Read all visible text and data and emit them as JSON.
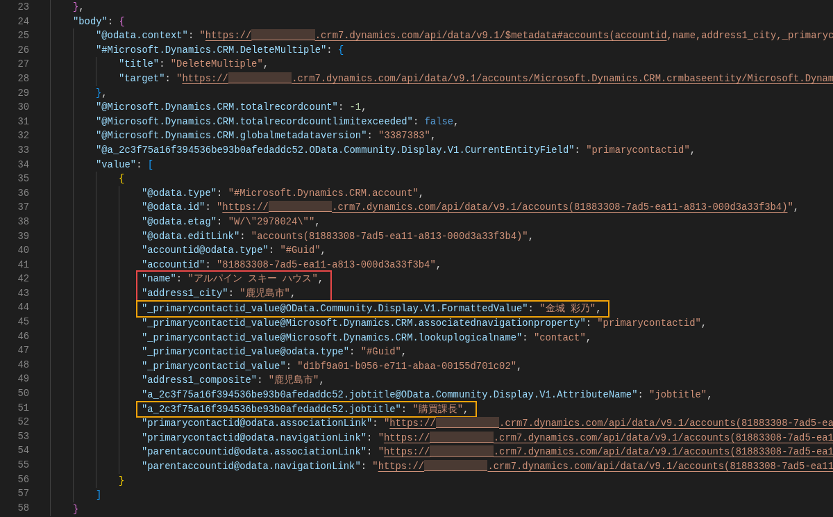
{
  "editor": {
    "lines": [
      {
        "number": "23",
        "tokens": [
          {
            "kind": "bracket",
            "text": "}",
            "color": "#da70d6"
          },
          {
            "kind": "punct",
            "text": ","
          }
        ]
      },
      {
        "number": "24",
        "tokens": [
          {
            "kind": "key",
            "text": "\"body\""
          },
          {
            "kind": "punct",
            "text": ": "
          },
          {
            "kind": "bracket",
            "text": "{",
            "color": "#da70d6"
          }
        ],
        "children": [
          {
            "number": "25",
            "tokens": [
              {
                "kind": "key",
                "text": "\"@odata.context\""
              },
              {
                "kind": "punct",
                "text": ": "
              },
              {
                "kind": "string",
                "text": "\""
              },
              {
                "kind": "link",
                "text": "https://"
              },
              {
                "kind": "redacted"
              },
              {
                "kind": "link",
                "text": ".crm7.dynamics.com/api/data/v9.1/$metadata#accounts(accountid"
              },
              {
                "kind": "string",
                "text": ",name,address1_city,_primaryc"
              }
            ]
          },
          {
            "number": "26",
            "tokens": [
              {
                "kind": "key",
                "text": "\"#Microsoft.Dynamics.CRM.DeleteMultiple\""
              },
              {
                "kind": "punct",
                "text": ": "
              },
              {
                "kind": "bracket",
                "text": "{",
                "color": "#179fff"
              }
            ],
            "children": [
              {
                "number": "27",
                "tokens": [
                  {
                    "kind": "key",
                    "text": "\"title\""
                  },
                  {
                    "kind": "punct",
                    "text": ": "
                  },
                  {
                    "kind": "string",
                    "text": "\"DeleteMultiple\""
                  },
                  {
                    "kind": "punct",
                    "text": ","
                  }
                ]
              },
              {
                "number": "28",
                "tokens": [
                  {
                    "kind": "key",
                    "text": "\"target\""
                  },
                  {
                    "kind": "punct",
                    "text": ": "
                  },
                  {
                    "kind": "string",
                    "text": "\""
                  },
                  {
                    "kind": "link",
                    "text": "https://"
                  },
                  {
                    "kind": "redacted"
                  },
                  {
                    "kind": "link",
                    "text": ".crm7.dynamics.com/api/data/v9.1/accounts/Microsoft.Dynamics.CRM.crmbaseentity/Microsoft.Dynam"
                  }
                ]
              }
            ]
          },
          {
            "number": "29",
            "tokens": [
              {
                "kind": "bracket",
                "text": "}",
                "color": "#179fff"
              },
              {
                "kind": "punct",
                "text": ","
              }
            ]
          },
          {
            "number": "30",
            "tokens": [
              {
                "kind": "key",
                "text": "\"@Microsoft.Dynamics.CRM.totalrecordcount\""
              },
              {
                "kind": "punct",
                "text": ": "
              },
              {
                "kind": "number",
                "text": "-1"
              },
              {
                "kind": "punct",
                "text": ","
              }
            ]
          },
          {
            "number": "31",
            "tokens": [
              {
                "kind": "key",
                "text": "\"@Microsoft.Dynamics.CRM.totalrecordcountlimitexceeded\""
              },
              {
                "kind": "punct",
                "text": ": "
              },
              {
                "kind": "keyword",
                "text": "false"
              },
              {
                "kind": "punct",
                "text": ","
              }
            ]
          },
          {
            "number": "32",
            "tokens": [
              {
                "kind": "key",
                "text": "\"@Microsoft.Dynamics.CRM.globalmetadataversion\""
              },
              {
                "kind": "punct",
                "text": ": "
              },
              {
                "kind": "string",
                "text": "\"3387383\""
              },
              {
                "kind": "punct",
                "text": ","
              }
            ]
          },
          {
            "number": "33",
            "tokens": [
              {
                "kind": "key",
                "text": "\"@a_2c3f75a16f394536be93b0afedaddc52.OData.Community.Display.V1.CurrentEntityField\""
              },
              {
                "kind": "punct",
                "text": ": "
              },
              {
                "kind": "string",
                "text": "\"primarycontactid\""
              },
              {
                "kind": "punct",
                "text": ","
              }
            ]
          },
          {
            "number": "34",
            "tokens": [
              {
                "kind": "key",
                "text": "\"value\""
              },
              {
                "kind": "punct",
                "text": ": "
              },
              {
                "kind": "bracket",
                "text": "[",
                "color": "#179fff"
              }
            ],
            "children": [
              {
                "number": "35",
                "tokens": [
                  {
                    "kind": "bracket",
                    "text": "{",
                    "color": "#ffd700"
                  }
                ],
                "children": [
                  {
                    "number": "36",
                    "tokens": [
                      {
                        "kind": "key",
                        "text": "\"@odata.type\""
                      },
                      {
                        "kind": "punct",
                        "text": ": "
                      },
                      {
                        "kind": "string",
                        "text": "\"#Microsoft.Dynamics.CRM.account\""
                      },
                      {
                        "kind": "punct",
                        "text": ","
                      }
                    ]
                  },
                  {
                    "number": "37",
                    "tokens": [
                      {
                        "kind": "key",
                        "text": "\"@odata.id\""
                      },
                      {
                        "kind": "punct",
                        "text": ": "
                      },
                      {
                        "kind": "string",
                        "text": "\""
                      },
                      {
                        "kind": "link",
                        "text": "https://"
                      },
                      {
                        "kind": "redacted"
                      },
                      {
                        "kind": "link",
                        "text": ".crm7.dynamics.com/api/data/v9.1/accounts(81883308-7ad5-ea11-a813-000d3a33f3b4)"
                      },
                      {
                        "kind": "string",
                        "text": "\""
                      },
                      {
                        "kind": "punct",
                        "text": ","
                      }
                    ]
                  },
                  {
                    "number": "38",
                    "tokens": [
                      {
                        "kind": "key",
                        "text": "\"@odata.etag\""
                      },
                      {
                        "kind": "punct",
                        "text": ": "
                      },
                      {
                        "kind": "string",
                        "text": "\"W/\\\"2978024\\\"\""
                      },
                      {
                        "kind": "punct",
                        "text": ","
                      }
                    ]
                  },
                  {
                    "number": "39",
                    "tokens": [
                      {
                        "kind": "key",
                        "text": "\"@odata.editLink\""
                      },
                      {
                        "kind": "punct",
                        "text": ": "
                      },
                      {
                        "kind": "string",
                        "text": "\"accounts(81883308-7ad5-ea11-a813-000d3a33f3b4)\""
                      },
                      {
                        "kind": "punct",
                        "text": ","
                      }
                    ]
                  },
                  {
                    "number": "40",
                    "tokens": [
                      {
                        "kind": "key",
                        "text": "\"accountid@odata.type\""
                      },
                      {
                        "kind": "punct",
                        "text": ": "
                      },
                      {
                        "kind": "string",
                        "text": "\"#Guid\""
                      },
                      {
                        "kind": "punct",
                        "text": ","
                      }
                    ]
                  },
                  {
                    "number": "41",
                    "tokens": [
                      {
                        "kind": "key",
                        "text": "\"accountid\""
                      },
                      {
                        "kind": "punct",
                        "text": ": "
                      },
                      {
                        "kind": "string",
                        "text": "\"81883308-7ad5-ea11-a813-000d3a33f3b4\""
                      },
                      {
                        "kind": "punct",
                        "text": ","
                      }
                    ]
                  },
                  {
                    "number": "42",
                    "color": "#e84848",
                    "tokens": [
                      {
                        "kind": "key",
                        "text": "\"name\""
                      },
                      {
                        "kind": "punct",
                        "text": ": "
                      },
                      {
                        "kind": "string",
                        "text": "\"アルパイン スキー ハウス\""
                      },
                      {
                        "kind": "punct",
                        "text": ","
                      }
                    ]
                  },
                  {
                    "number": "43",
                    "color": "#e84848",
                    "tokens": [
                      {
                        "kind": "key",
                        "text": "\"address1_city\""
                      },
                      {
                        "kind": "punct",
                        "text": ": "
                      },
                      {
                        "kind": "string",
                        "text": "\"鹿児島市\""
                      },
                      {
                        "kind": "punct",
                        "text": ","
                      }
                    ]
                  },
                  {
                    "number": "44",
                    "color": "#f0a30a",
                    "tokens": [
                      {
                        "kind": "key",
                        "text": "\"_primarycontactid_value@OData.Community.Display.V1.FormattedValue\""
                      },
                      {
                        "kind": "punct",
                        "text": ": "
                      },
                      {
                        "kind": "string",
                        "text": "\"金城 彩乃\""
                      },
                      {
                        "kind": "punct",
                        "text": ","
                      }
                    ]
                  },
                  {
                    "number": "45",
                    "tokens": [
                      {
                        "kind": "key",
                        "text": "\"_primarycontactid_value@Microsoft.Dynamics.CRM.associatednavigationproperty\""
                      },
                      {
                        "kind": "punct",
                        "text": ": "
                      },
                      {
                        "kind": "string",
                        "text": "\"primarycontactid\""
                      },
                      {
                        "kind": "punct",
                        "text": ","
                      }
                    ]
                  },
                  {
                    "number": "46",
                    "tokens": [
                      {
                        "kind": "key",
                        "text": "\"_primarycontactid_value@Microsoft.Dynamics.CRM.lookuplogicalname\""
                      },
                      {
                        "kind": "punct",
                        "text": ": "
                      },
                      {
                        "kind": "string",
                        "text": "\"contact\""
                      },
                      {
                        "kind": "punct",
                        "text": ","
                      }
                    ]
                  },
                  {
                    "number": "47",
                    "tokens": [
                      {
                        "kind": "key",
                        "text": "\"_primarycontactid_value@odata.type\""
                      },
                      {
                        "kind": "punct",
                        "text": ": "
                      },
                      {
                        "kind": "string",
                        "text": "\"#Guid\""
                      },
                      {
                        "kind": "punct",
                        "text": ","
                      }
                    ]
                  },
                  {
                    "number": "48",
                    "tokens": [
                      {
                        "kind": "key",
                        "text": "\"_primarycontactid_value\""
                      },
                      {
                        "kind": "punct",
                        "text": ": "
                      },
                      {
                        "kind": "string",
                        "text": "\"d1bf9a01-b056-e711-abaa-00155d701c02\""
                      },
                      {
                        "kind": "punct",
                        "text": ","
                      }
                    ]
                  },
                  {
                    "number": "49",
                    "tokens": [
                      {
                        "kind": "key",
                        "text": "\"address1_composite\""
                      },
                      {
                        "kind": "punct",
                        "text": ": "
                      },
                      {
                        "kind": "string",
                        "text": "\"鹿児島市\""
                      },
                      {
                        "kind": "punct",
                        "text": ","
                      }
                    ]
                  },
                  {
                    "number": "50",
                    "tokens": [
                      {
                        "kind": "key",
                        "text": "\"a_2c3f75a16f394536be93b0afedaddc52.jobtitle@OData.Community.Display.V1.AttributeName\""
                      },
                      {
                        "kind": "punct",
                        "text": ": "
                      },
                      {
                        "kind": "string",
                        "text": "\"jobtitle\""
                      },
                      {
                        "kind": "punct",
                        "text": ","
                      }
                    ]
                  },
                  {
                    "number": "51",
                    "color": "#f0a30a",
                    "tokens": [
                      {
                        "kind": "key",
                        "text": "\"a_2c3f75a16f394536be93b0afedaddc52.jobtitle\""
                      },
                      {
                        "kind": "punct",
                        "text": ": "
                      },
                      {
                        "kind": "string",
                        "text": "\"購買課長\""
                      },
                      {
                        "kind": "punct",
                        "text": ","
                      }
                    ]
                  },
                  {
                    "number": "52",
                    "tokens": [
                      {
                        "kind": "key",
                        "text": "\"primarycontactid@odata.associationLink\""
                      },
                      {
                        "kind": "punct",
                        "text": ": "
                      },
                      {
                        "kind": "string",
                        "text": "\""
                      },
                      {
                        "kind": "link",
                        "text": "https://"
                      },
                      {
                        "kind": "redacted"
                      },
                      {
                        "kind": "link",
                        "text": ".crm7.dynamics.com/api/data/v9.1/accounts(81883308-7ad5-ea"
                      }
                    ]
                  },
                  {
                    "number": "53",
                    "tokens": [
                      {
                        "kind": "key",
                        "text": "\"primarycontactid@odata.navigationLink\""
                      },
                      {
                        "kind": "punct",
                        "text": ": "
                      },
                      {
                        "kind": "string",
                        "text": "\""
                      },
                      {
                        "kind": "link",
                        "text": "https://"
                      },
                      {
                        "kind": "redacted"
                      },
                      {
                        "kind": "link",
                        "text": ".crm7.dynamics.com/api/data/v9.1/accounts(81883308-7ad5-ea1"
                      }
                    ]
                  },
                  {
                    "number": "54",
                    "tokens": [
                      {
                        "kind": "key",
                        "text": "\"parentaccountid@odata.associationLink\""
                      },
                      {
                        "kind": "punct",
                        "text": ": "
                      },
                      {
                        "kind": "string",
                        "text": "\""
                      },
                      {
                        "kind": "link",
                        "text": "https://"
                      },
                      {
                        "kind": "redacted"
                      },
                      {
                        "kind": "link",
                        "text": ".crm7.dynamics.com/api/data/v9.1/accounts(81883308-7ad5-ea1"
                      }
                    ]
                  },
                  {
                    "number": "55",
                    "tokens": [
                      {
                        "kind": "key",
                        "text": "\"parentaccountid@odata.navigationLink\""
                      },
                      {
                        "kind": "punct",
                        "text": ": "
                      },
                      {
                        "kind": "string",
                        "text": "\""
                      },
                      {
                        "kind": "link",
                        "text": "https://"
                      },
                      {
                        "kind": "redacted"
                      },
                      {
                        "kind": "link",
                        "text": ".crm7.dynamics.com/api/data/v9.1/accounts(81883308-7ad5-ea11"
                      }
                    ]
                  }
                ]
              },
              {
                "number": "56",
                "tokens": [
                  {
                    "kind": "bracket",
                    "text": "}",
                    "color": "#ffd700"
                  }
                ]
              }
            ]
          },
          {
            "number": "57",
            "tokens": [
              {
                "kind": "bracket",
                "text": "]",
                "color": "#179fff"
              }
            ]
          }
        ]
      },
      {
        "number": "58",
        "tokens": [
          {
            "kind": "bracket",
            "text": "}",
            "color": "#da70d6"
          }
        ]
      }
    ]
  }
}
